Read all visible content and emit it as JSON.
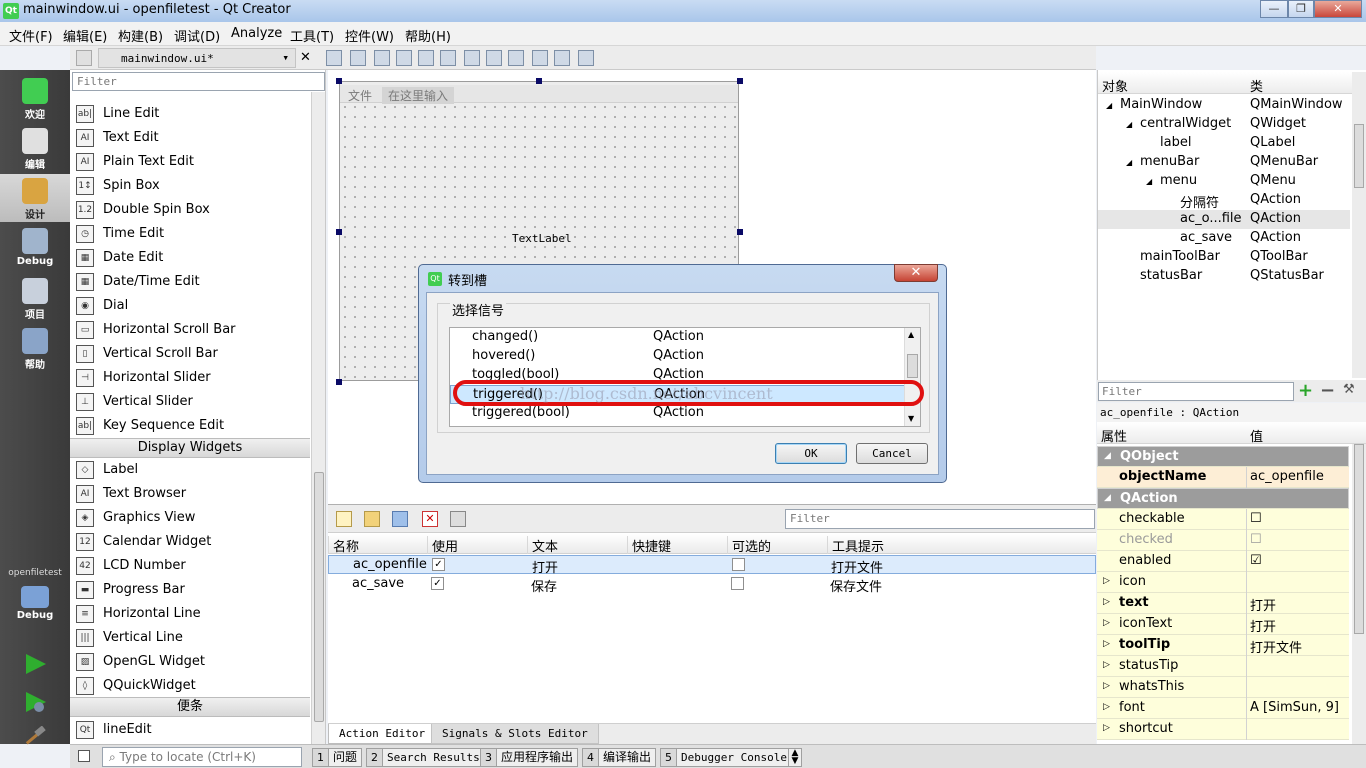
{
  "window": {
    "app_icon": "Qt",
    "title": "mainwindow.ui - openfiletest - Qt Creator",
    "minimize_glyph": "—",
    "restore_glyph": "❐",
    "close_glyph": "✕"
  },
  "menu": [
    "文件(F)",
    "编辑(E)",
    "构建(B)",
    "调试(D)",
    "Analyze",
    "工具(T)",
    "控件(W)",
    "帮助(H)"
  ],
  "editor": {
    "file_name": "mainwindow.ui*",
    "file_icon": "pencil-doc-icon"
  },
  "modes": [
    {
      "label": "欢迎",
      "icon": "qt-logo-icon",
      "color": "#41cd52"
    },
    {
      "label": "编辑",
      "icon": "document-icon",
      "color": "#e0e0e0"
    },
    {
      "label": "设计",
      "icon": "brush-icon",
      "color": "#d9a441"
    },
    {
      "label": "Debug",
      "icon": "bug-icon",
      "color": "#a0b4cc"
    },
    {
      "label": "项目",
      "icon": "folder-icon",
      "color": "#c8d0dc"
    },
    {
      "label": "帮助",
      "icon": "help-icon",
      "color": "#8aa4c8"
    }
  ],
  "target": {
    "project": "openfiletest",
    "config": "Debug"
  },
  "widget_box": {
    "filter_placeholder": "Filter",
    "items_a": [
      {
        "label": "Line Edit",
        "icon": "ab|"
      },
      {
        "label": "Text Edit",
        "icon": "AI"
      },
      {
        "label": "Plain Text Edit",
        "icon": "AI"
      },
      {
        "label": "Spin Box",
        "icon": "1↕"
      },
      {
        "label": "Double Spin Box",
        "icon": "1.2"
      },
      {
        "label": "Time Edit",
        "icon": "◷"
      },
      {
        "label": "Date Edit",
        "icon": "▦"
      },
      {
        "label": "Date/Time Edit",
        "icon": "▦"
      },
      {
        "label": "Dial",
        "icon": "◉"
      },
      {
        "label": "Horizontal Scroll Bar",
        "icon": "▭"
      },
      {
        "label": "Vertical Scroll Bar",
        "icon": "▯"
      },
      {
        "label": "Horizontal Slider",
        "icon": "⊣"
      },
      {
        "label": "Vertical Slider",
        "icon": "⊥"
      },
      {
        "label": "Key Sequence Edit",
        "icon": "ab|"
      }
    ],
    "category_display": "Display Widgets",
    "items_b": [
      {
        "label": "Label",
        "icon": "◇"
      },
      {
        "label": "Text Browser",
        "icon": "AI"
      },
      {
        "label": "Graphics View",
        "icon": "◈"
      },
      {
        "label": "Calendar Widget",
        "icon": "12"
      },
      {
        "label": "LCD Number",
        "icon": "42"
      },
      {
        "label": "Progress Bar",
        "icon": "▬"
      },
      {
        "label": "Horizontal Line",
        "icon": "≡"
      },
      {
        "label": "Vertical Line",
        "icon": "|||"
      },
      {
        "label": "OpenGL Widget",
        "icon": "▨"
      },
      {
        "label": "QQuickWidget",
        "icon": "◊"
      }
    ],
    "category_custom": "便条",
    "items_c": [
      {
        "label": "lineEdit",
        "icon": "Qt"
      }
    ]
  },
  "form": {
    "menu_file": "文件",
    "menu_placeholder": "在这里输入",
    "text_label": "TextLabel"
  },
  "dialog": {
    "title": "转到槽",
    "close": "✕",
    "group_label": "选择信号",
    "signals": [
      {
        "name": "changed()",
        "cls": "QAction"
      },
      {
        "name": "hovered()",
        "cls": "QAction"
      },
      {
        "name": "toggled(bool)",
        "cls": "QAction"
      },
      {
        "name": "triggered()",
        "cls": "QAction"
      },
      {
        "name": "triggered(bool)",
        "cls": "QAction"
      }
    ],
    "watermark": "http://blog.csdn.net/abcvincent",
    "ok": "OK",
    "cancel": "Cancel"
  },
  "action_editor": {
    "filter_placeholder": "Filter",
    "columns": [
      "名称",
      "使用",
      "文本",
      "快捷键",
      "可选的",
      "工具提示"
    ],
    "rows": [
      {
        "name": "ac_openfile",
        "used": "✓",
        "text": "打开",
        "shortcut": "",
        "checkable": "",
        "tooltip": "打开文件"
      },
      {
        "name": "ac_save",
        "used": "✓",
        "text": "保存",
        "shortcut": "",
        "checkable": "",
        "tooltip": "保存文件"
      }
    ],
    "tabs": [
      "Action Editor",
      "Signals & Slots Editor"
    ]
  },
  "object_inspector": {
    "col_object": "对象",
    "col_class": "类",
    "rows": [
      {
        "name": "MainWindow",
        "cls": "QMainWindow",
        "indent": 0,
        "arrow": "◢"
      },
      {
        "name": "centralWidget",
        "cls": "QWidget",
        "indent": 1,
        "arrow": "◢"
      },
      {
        "name": "label",
        "cls": "QLabel",
        "indent": 2,
        "arrow": ""
      },
      {
        "name": "menuBar",
        "cls": "QMenuBar",
        "indent": 1,
        "arrow": "◢"
      },
      {
        "name": "menu",
        "cls": "QMenu",
        "indent": 2,
        "arrow": "◢"
      },
      {
        "name": "分隔符",
        "cls": "QAction",
        "indent": 3,
        "arrow": ""
      },
      {
        "name": "ac_o...file",
        "cls": "QAction",
        "indent": 3,
        "arrow": ""
      },
      {
        "name": "ac_save",
        "cls": "QAction",
        "indent": 3,
        "arrow": ""
      },
      {
        "name": "mainToolBar",
        "cls": "QToolBar",
        "indent": 1,
        "arrow": ""
      },
      {
        "name": "statusBar",
        "cls": "QStatusBar",
        "indent": 1,
        "arrow": ""
      }
    ]
  },
  "property_editor": {
    "filter_placeholder": "Filter",
    "add": "+",
    "remove": "−",
    "wrench": "🔧",
    "object_label": "ac_openfile : QAction",
    "col_property": "属性",
    "col_value": "值",
    "rows": [
      {
        "name": "QObject",
        "value": "",
        "type": "group"
      },
      {
        "name": "objectName",
        "value": "ac_openfile",
        "type": "orange-bold"
      },
      {
        "name": "QAction",
        "value": "",
        "type": "group"
      },
      {
        "name": "checkable",
        "value": "☐",
        "type": "yellow"
      },
      {
        "name": "checked",
        "value": "☐",
        "type": "yellow-dim"
      },
      {
        "name": "enabled",
        "value": "☑",
        "type": "yellow"
      },
      {
        "name": "icon",
        "value": "",
        "type": "yellow-arrow"
      },
      {
        "name": "text",
        "value": "打开",
        "type": "yellow-bold-arrow"
      },
      {
        "name": "iconText",
        "value": "打开",
        "type": "yellow-arrow"
      },
      {
        "name": "toolTip",
        "value": "打开文件",
        "type": "yellow-bold-arrow"
      },
      {
        "name": "statusTip",
        "value": "",
        "type": "yellow-arrow"
      },
      {
        "name": "whatsThis",
        "value": "",
        "type": "yellow-arrow"
      },
      {
        "name": "font",
        "value": "A  [SimSun, 9]",
        "type": "yellow-arrow"
      },
      {
        "name": "shortcut",
        "value": "",
        "type": "yellow-arrow"
      }
    ]
  },
  "statusbar": {
    "locate_placeholder": "Type to locate (Ctrl+K)",
    "tabs": [
      {
        "n": "1",
        "t": "问题"
      },
      {
        "n": "2",
        "t": "Search Results"
      },
      {
        "n": "3",
        "t": "应用程序输出"
      },
      {
        "n": "4",
        "t": "编译输出"
      },
      {
        "n": "5",
        "t": "Debugger Console"
      }
    ]
  }
}
